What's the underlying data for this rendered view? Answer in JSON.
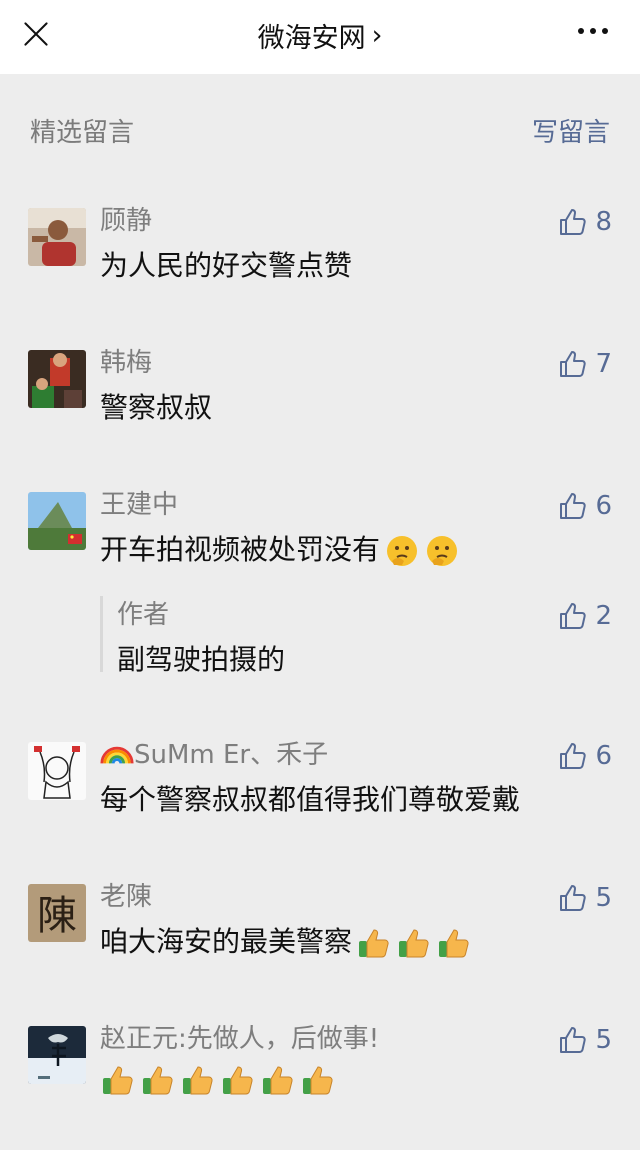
{
  "header": {
    "title": "微海安网",
    "chevron": "›"
  },
  "section": {
    "title": "精选留言",
    "write_label": "写留言"
  },
  "comments": [
    {
      "nick": "顾静",
      "likes": "8",
      "text": "为人民的好交警点赞",
      "avatar_color": "#b79e8a"
    },
    {
      "nick": "韩梅",
      "likes": "7",
      "text": "警察叔叔",
      "avatar_color": "#4d3a2e"
    },
    {
      "nick": "王建中",
      "likes": "6",
      "text": "开车拍视频被处罚没有",
      "emoji": "thinking-face",
      "avatar_color": "#6fa7d8",
      "reply": {
        "nick": "作者",
        "likes": "2",
        "text": "副驾驶拍摄的"
      }
    },
    {
      "nick_emoji": "rainbow",
      "nick": "SuMm Er、禾子",
      "likes": "6",
      "text": "每个警察叔叔都值得我们尊敬爱戴",
      "avatar_color": "#ffffff"
    },
    {
      "nick": "老陳",
      "likes": "5",
      "text": "咱大海安的最美警察",
      "emoji": "thumbs-up",
      "avatar_color": "#8b7355",
      "avatar_char": "陳"
    },
    {
      "nick": "赵正元:先做人，后做事!",
      "likes": "5",
      "text": "",
      "emoji": "thumbs-up",
      "avatar_color": "#1c2a3a"
    }
  ],
  "colors": {
    "link": "#576b95",
    "background": "#ededed",
    "secondary_text": "#7e7e7e"
  },
  "icons": {
    "close": "close-icon",
    "more": "more-icon",
    "like": "thumbs-up-outline-icon"
  }
}
